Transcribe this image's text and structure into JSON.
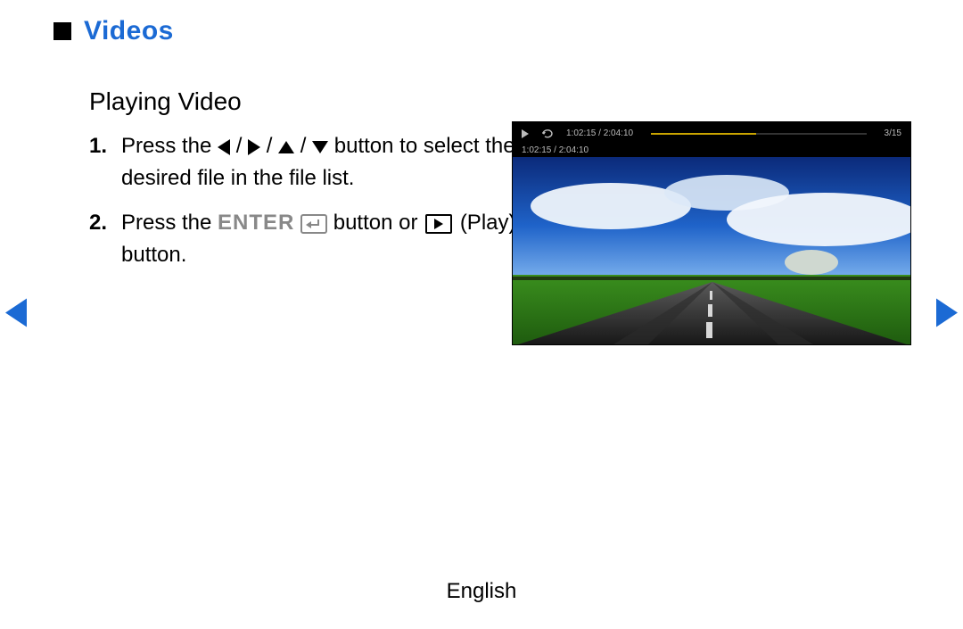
{
  "section": {
    "title": "Videos",
    "subheading": "Playing Video"
  },
  "steps": {
    "s1": {
      "num": "1.",
      "part_a": "Press the ",
      "sep": " / ",
      "part_b": " button to select the desired file in the file list."
    },
    "s2": {
      "num": "2.",
      "part_a": "Press the ",
      "enter_label": "ENTER",
      "part_b": " button or ",
      "play_label": " (Play) button."
    }
  },
  "player": {
    "time_top": "1:02:15 / 2:04:10",
    "count": "3/15",
    "time_sub": "1:02:15 / 2:04:10",
    "progress_pct": 49
  },
  "footer": {
    "language": "English"
  }
}
